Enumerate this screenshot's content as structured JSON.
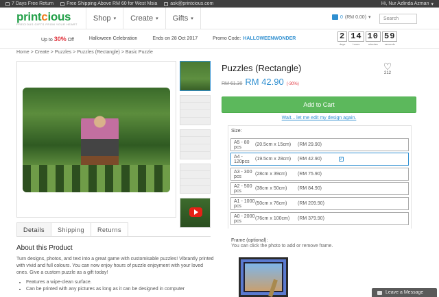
{
  "topbar": {
    "return": "7 Days Free Return",
    "shipping": "Free Shipping Above RM 60 for West Msia",
    "email": "ask@printcious.com",
    "greeting": "Hi, Nur Azlinda Azman"
  },
  "logo": {
    "text_a": "print",
    "text_o": "c",
    "text_b": "ious",
    "tagline": "PRECIOUS GIFTS FROM YOUR HEART"
  },
  "nav": {
    "items": [
      {
        "label": "Shop"
      },
      {
        "label": "Create"
      },
      {
        "label": "Gifts"
      }
    ],
    "caret": "▾",
    "cart_count": "0",
    "cart_total": "(RM 0.00)",
    "search_label": "Search"
  },
  "promo": {
    "upto": "Up to",
    "percent": "30%",
    "off": "Off",
    "event": "Halloween Celebration",
    "ends": "Ends on 28 Oct 2017",
    "code_label": "Promo Code:",
    "code": "HALLOWEENWONDER",
    "timer": [
      {
        "value": "2",
        "label": "days"
      },
      {
        "value": "14",
        "label": "hours"
      },
      {
        "value": "10",
        "label": "minutes"
      },
      {
        "value": "59",
        "label": "seconds"
      }
    ]
  },
  "breadcrumb": [
    "Home",
    "Create",
    "Puzzles",
    "Puzzles (Rectangle)",
    "Basic Puzzle"
  ],
  "breadcrumb_sep": ">",
  "product": {
    "title": "Puzzles (Rectangle)",
    "likes": "212",
    "old_price": "RM 61.30",
    "price": "RM 42.90",
    "discount": "(-30%)",
    "add_to_cart": "Add to Cart",
    "edit_link": "Wait... let me edit my design again.",
    "size_label": "Size:",
    "sizes": [
      {
        "name": "A5 - 80 pcs",
        "dim": "(20.5cm x 15cm)",
        "price": "(RM 29.90)",
        "selected": false
      },
      {
        "name": "A4 - 120pcs",
        "dim": "(19.5cm x 28cm)",
        "price": "(RM 42.90)",
        "selected": true
      },
      {
        "name": "A3 - 300 pcs",
        "dim": "(28cm x 39cm)",
        "price": "(RM 75.90)",
        "selected": false
      },
      {
        "name": "A2 - 500 pcs",
        "dim": "(38cm x 50cm)",
        "price": "(RM 84.90)",
        "selected": false
      },
      {
        "name": "A1 - 1000 pcs",
        "dim": "(50cm x 76cm)",
        "price": "(RM 209.90)",
        "selected": false
      },
      {
        "name": "A0 - 2000 pcs",
        "dim": "(76cm x 100cm)",
        "price": "(RM 379.90)",
        "selected": false
      }
    ],
    "frame_label": "Frame (optional):",
    "frame_hint": "You can click the photo to add or remove frame."
  },
  "tabs": [
    {
      "label": "Details",
      "active": true
    },
    {
      "label": "Shipping",
      "active": false
    },
    {
      "label": "Returns",
      "active": false
    }
  ],
  "about": {
    "title": "About this Product",
    "body": "Turn designs, photos, and text into a great game with customisable puzzles! Vibrantly printed with vivid and full colours. You can now enjoy hours of puzzle enjoyment with your loved ones. Give a custom puzzle as a gift today!",
    "bullets": [
      "Features a wipe-clean surface.",
      "Can be printed with any pictures as long as it can be designed in computer"
    ]
  },
  "chat": {
    "label": "Leave a Message"
  }
}
